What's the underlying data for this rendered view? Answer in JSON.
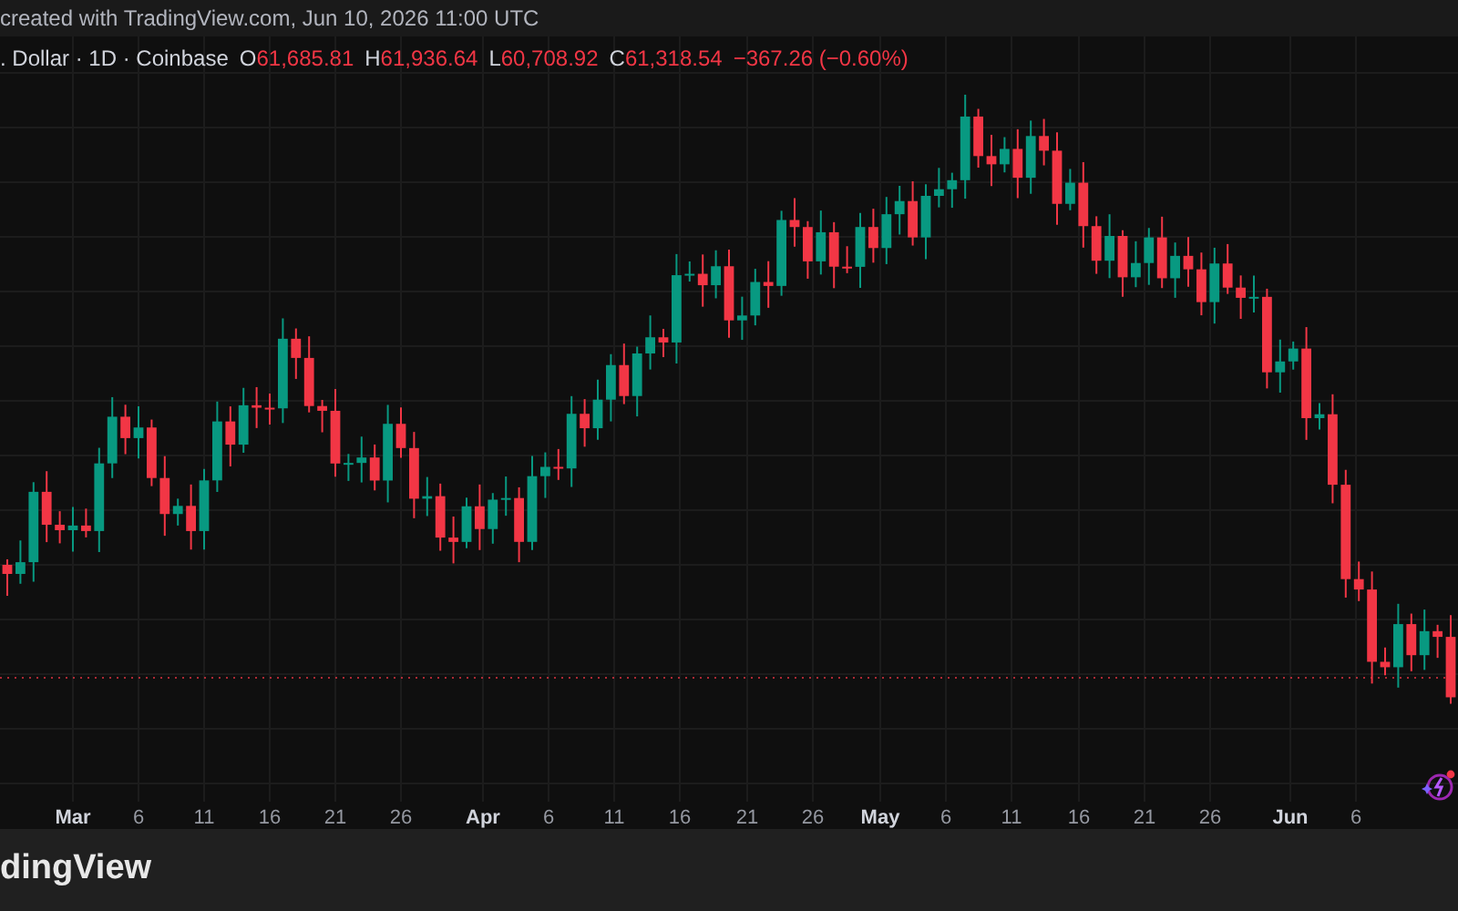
{
  "header": {
    "text": "created with TradingView.com, Jun 10, 2026 11:00 UTC"
  },
  "legend": {
    "symbol": ". Dollar · 1D · Coinbase",
    "negative": true,
    "ohlc": [
      {
        "label": "O",
        "value": "61,685.81"
      },
      {
        "label": "H",
        "value": "61,936.64"
      },
      {
        "label": "L",
        "value": "60,708.92"
      },
      {
        "label": "C",
        "value": "61,318.54"
      }
    ],
    "change": "−367.26 (−0.60%)"
  },
  "x_axis": {
    "labels": [
      {
        "text": "Mar",
        "kind": "month"
      },
      {
        "text": "6",
        "kind": "day"
      },
      {
        "text": "11",
        "kind": "day"
      },
      {
        "text": "16",
        "kind": "day"
      },
      {
        "text": "21",
        "kind": "day"
      },
      {
        "text": "26",
        "kind": "day"
      },
      {
        "text": "Apr",
        "kind": "month"
      },
      {
        "text": "6",
        "kind": "day"
      },
      {
        "text": "11",
        "kind": "day"
      },
      {
        "text": "16",
        "kind": "day"
      },
      {
        "text": "21",
        "kind": "day"
      },
      {
        "text": "26",
        "kind": "day"
      },
      {
        "text": "May",
        "kind": "month"
      },
      {
        "text": "6",
        "kind": "day"
      },
      {
        "text": "11",
        "kind": "day"
      },
      {
        "text": "16",
        "kind": "day"
      },
      {
        "text": "21",
        "kind": "day"
      },
      {
        "text": "26",
        "kind": "day"
      },
      {
        "text": "Jun",
        "kind": "month"
      },
      {
        "text": "6",
        "kind": "day"
      }
    ]
  },
  "footer": {
    "logo_text": "dingView"
  }
}
